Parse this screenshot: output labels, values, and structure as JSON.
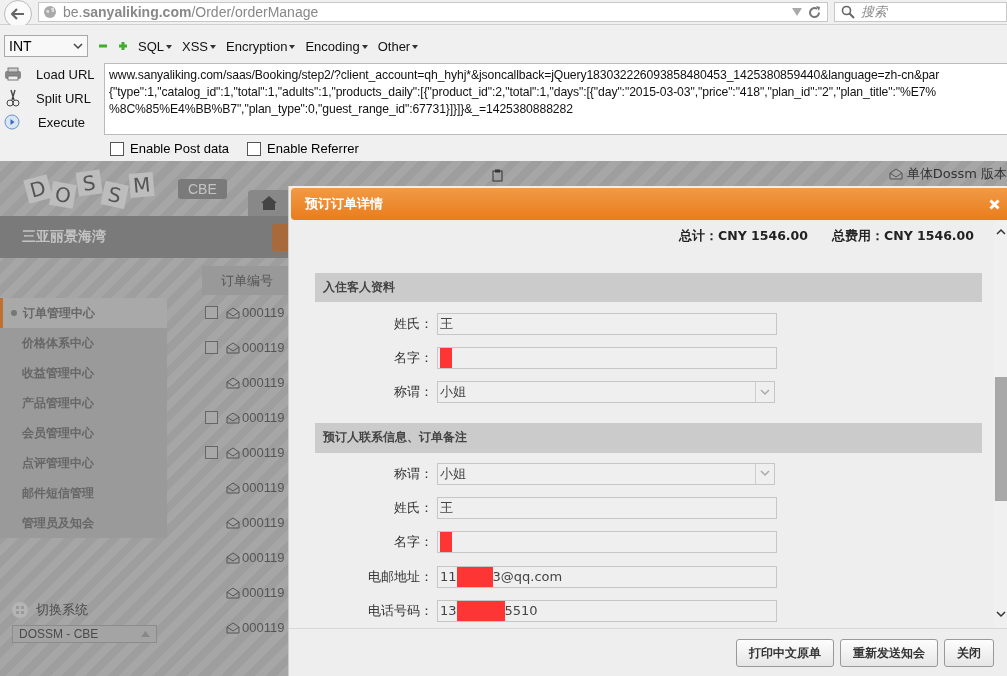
{
  "browser": {
    "url": "be.**sanyaliking.com**/Order/orderManage",
    "search_placeholder": "搜索"
  },
  "hackbar": {
    "type_select": "INT",
    "menus": [
      "SQL",
      "XSS",
      "Encryption",
      "Encoding",
      "Other"
    ],
    "actions": [
      {
        "label": "Load URL",
        "kind": "load"
      },
      {
        "label": "Split URL",
        "kind": "split"
      },
      {
        "label": "Execute",
        "kind": "execute"
      }
    ],
    "url_lines": [
      "www.sanyaliking.com/saas/Booking/step2/?client_account=qh_hyhj*&jsoncallback=jQuery183032226093858480453_1425380859440&language=zh-cn&par",
      "{\"type\":1,\"catalog_id\":1,\"total\":1,\"adults\":1,\"products_daily\":[{\"product_id\":2,\"total\":1,\"days\":[{\"day\":\"2015-03-03\",\"price\":\"418\",\"plan_id\":\"2\",\"plan_title\":\"%E7%",
      "%8C%85%E4%BB%B7\",\"plan_type\":0,\"guest_range_id\":67731}]}]}&_=1425380888282"
    ],
    "options": [
      {
        "label": "Enable Post data",
        "checked": false
      },
      {
        "label": "Enable Referrer",
        "checked": false
      }
    ]
  },
  "site": {
    "logo_letters": [
      "D",
      "O",
      "S",
      "S",
      "M"
    ],
    "logo_badge": "CBE",
    "hotel_name": "三亚丽景海湾",
    "top_right": "单体Dossm 版本",
    "menu": [
      {
        "label": "订单管理中心",
        "selected": true
      },
      {
        "label": "价格体系中心",
        "selected": false
      },
      {
        "label": "收益管理中心",
        "selected": false
      },
      {
        "label": "产品管理中心",
        "selected": false
      },
      {
        "label": "会员管理中心",
        "selected": false
      },
      {
        "label": "点评管理中心",
        "selected": false
      },
      {
        "label": "邮件短信管理",
        "selected": false
      },
      {
        "label": "管理员及知会",
        "selected": false
      }
    ],
    "switch_label": "切换系统",
    "switch_value": "DOSSM - CBE",
    "column_header": "订单编号",
    "orders": [
      {
        "number": "000119",
        "with_box": true,
        "checked": false
      },
      {
        "number": "000119",
        "with_box": true,
        "checked": false
      },
      {
        "number": "000119",
        "with_box": false
      },
      {
        "number": "000119",
        "with_box": true,
        "checked": false
      },
      {
        "number": "000119",
        "with_box": true,
        "checked": false
      },
      {
        "number": "000119",
        "with_box": false
      },
      {
        "number": "000119",
        "with_box": false
      },
      {
        "number": "000119",
        "with_box": false
      },
      {
        "number": "000119",
        "with_box": false
      },
      {
        "number": "000119",
        "with_box": false
      }
    ]
  },
  "dialog": {
    "title": "预订订单详情",
    "totals": [
      "总计：CNY 1546.00",
      "总费用：CNY 1546.00"
    ],
    "sections": [
      {
        "title": "入住客人资料",
        "fields": [
          {
            "label": "姓氏：",
            "kind": "text",
            "value": "王"
          },
          {
            "label": "名字：",
            "kind": "redacted"
          },
          {
            "label": "称谓：",
            "kind": "select",
            "value": "小姐"
          }
        ]
      },
      {
        "title": "预订人联系信息、订单备注",
        "fields": [
          {
            "label": "称谓：",
            "kind": "select",
            "value": "小姐"
          },
          {
            "label": "姓氏：",
            "kind": "text",
            "value": "王"
          },
          {
            "label": "名字：",
            "kind": "redacted"
          },
          {
            "label": "电邮地址：",
            "kind": "partial",
            "value": "11",
            "value_end": "3@qq.com"
          },
          {
            "label": "电话号码：",
            "kind": "partial",
            "value": "13",
            "value_end": "5510"
          }
        ]
      }
    ],
    "buttons": [
      "打印中文原单",
      "重新发送知会",
      "关闭"
    ]
  }
}
